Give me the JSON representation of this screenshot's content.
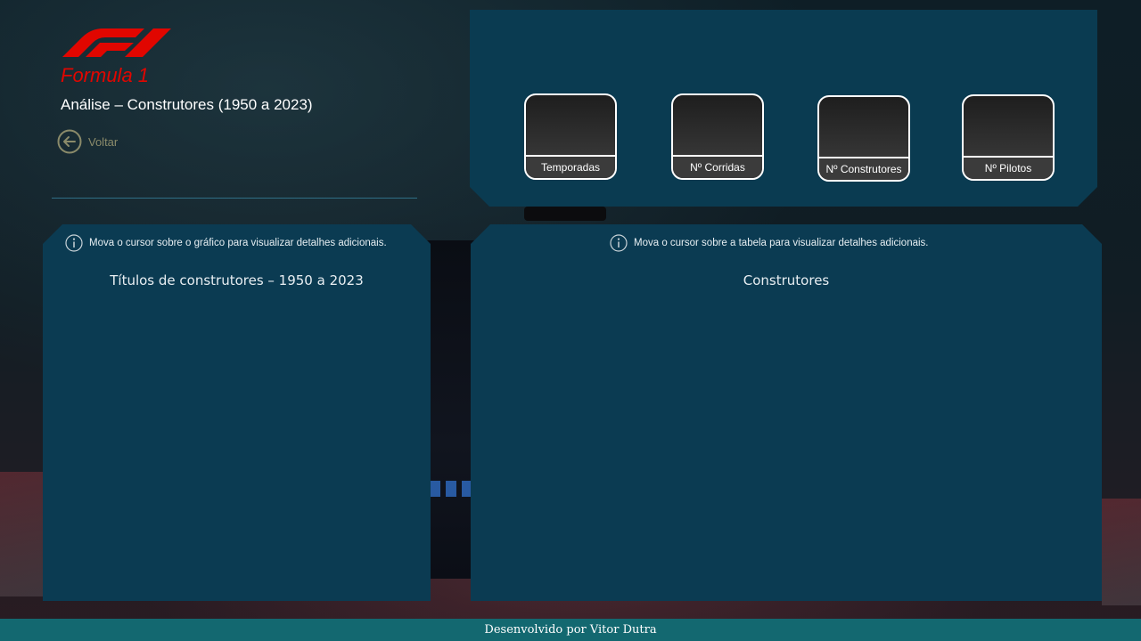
{
  "header": {
    "brand": "Formula 1",
    "subtitle": "Análise – Construtores (1950 a 2023)",
    "back_label": "Voltar",
    "logo_icon": "f1-logo-icon",
    "accent_color": "#e10600"
  },
  "kpis": [
    {
      "label": "Temporadas"
    },
    {
      "label": "Nº Corridas"
    },
    {
      "label": "Nº Construtores"
    },
    {
      "label": "Nº Pilotos"
    }
  ],
  "left_panel": {
    "hint": "Mova o cursor sobre o gráfico para visualizar detalhes adicionais.",
    "title": "Títulos de construtores – 1950 a 2023"
  },
  "right_panel": {
    "hint": "Mova o cursor sobre a tabela para visualizar detalhes adicionais.",
    "title": "Construtores"
  },
  "footer": {
    "text": "Desenvolvido por Vitor Dutra"
  },
  "colors": {
    "panel": "#0b3b52",
    "footer": "#136870",
    "divider": "#2f6f86"
  }
}
